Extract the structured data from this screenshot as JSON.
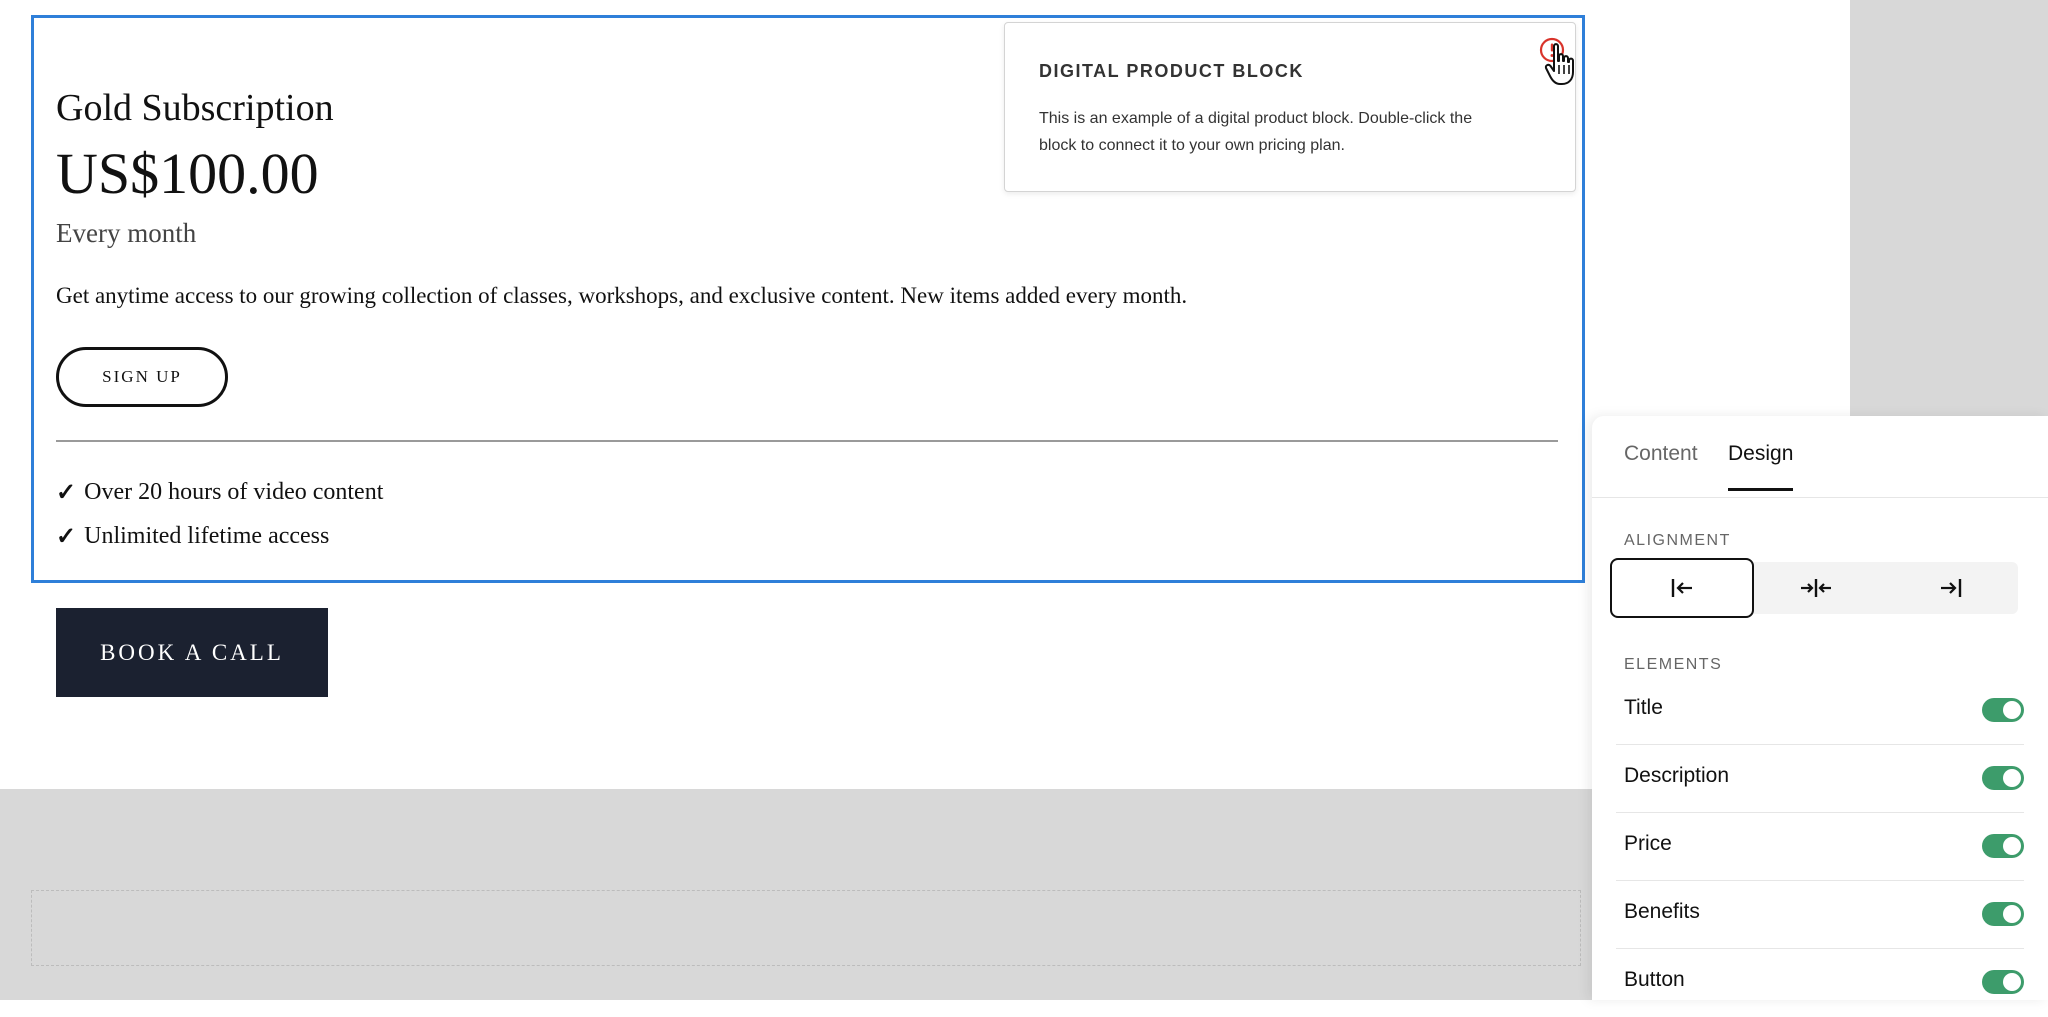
{
  "product": {
    "title": "Gold Subscription",
    "price": "US$100.00",
    "period": "Every month",
    "description": "Get anytime access to our growing collection of classes, workshops, and exclusive content. New items added every month.",
    "button_label": "SIGN UP",
    "benefits": [
      "Over 20 hours of video content",
      "Unlimited lifetime access"
    ],
    "check_glyph": "✓"
  },
  "tooltip": {
    "title": "DIGITAL PRODUCT BLOCK",
    "text": "This is an example of a digital product block. Double-click the block to connect it to your own pricing plan."
  },
  "cta": {
    "book_call_label": "BOOK A CALL"
  },
  "panel": {
    "tabs": [
      "Content",
      "Design"
    ],
    "active_tab": "Design",
    "alignment_label": "ALIGNMENT",
    "elements_label": "ELEMENTS",
    "elements": [
      {
        "label": "Title",
        "on": true
      },
      {
        "label": "Description",
        "on": true
      },
      {
        "label": "Price",
        "on": true
      },
      {
        "label": "Benefits",
        "on": true
      },
      {
        "label": "Button",
        "on": true
      }
    ]
  },
  "icons": {
    "alert": "alert-circle-icon",
    "cursor": "hand-pointer-icon",
    "align_left": "align-left-icon",
    "align_center": "align-center-icon",
    "align_right": "align-right-icon"
  },
  "colors": {
    "selection": "#2e7fd9",
    "toggle_on": "#3d9c6b",
    "cta_bg": "#1b2130",
    "alert": "#d9342b"
  }
}
